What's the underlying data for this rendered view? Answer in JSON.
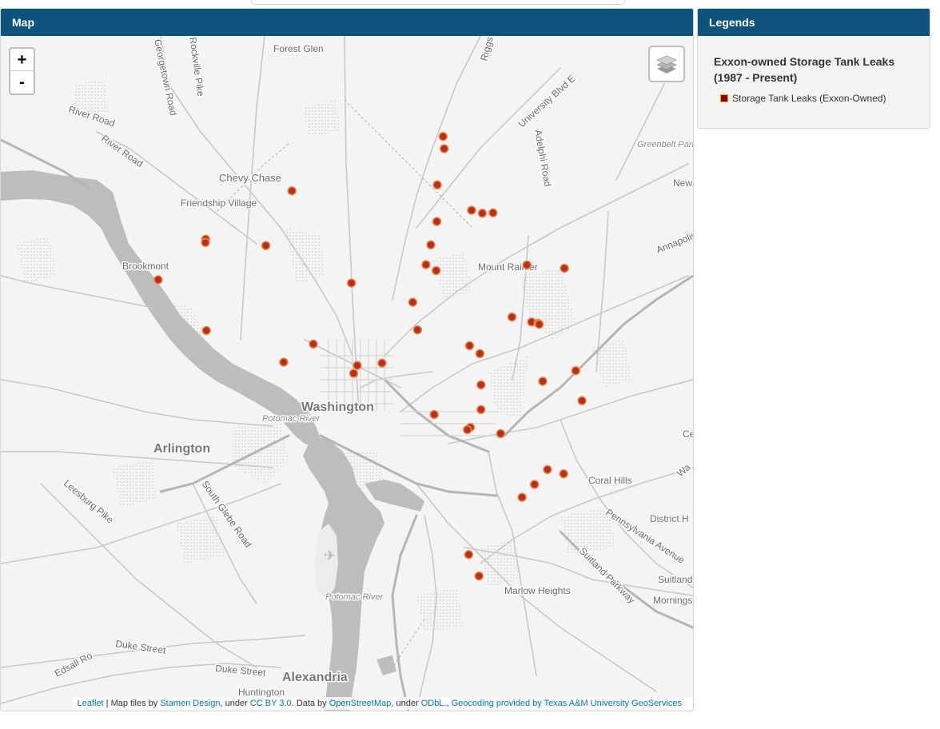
{
  "map_panel": {
    "title": "Map"
  },
  "legend_panel": {
    "title": "Legends",
    "layer_title": "Exxon-owned Storage Tank Leaks (1987 - Present)",
    "item_label": "Storage Tank Leaks (Exxon-Owned)",
    "swatch_fill": "#8b0000",
    "swatch_border": "#ffa500"
  },
  "zoom": {
    "in_label": "+",
    "out_label": "-"
  },
  "layers_control": {
    "icon": "layers-icon"
  },
  "colors": {
    "header": "#0e537c",
    "marker_fill": "#b5301f",
    "marker_stroke": "#f08c4a",
    "road": "#c8c8c8",
    "water": "#bcbcbc"
  },
  "place_labels": {
    "forest_glen": "Forest Glen",
    "chevy_chase": "Chevy Chase",
    "friendship_village": "Friendship Village",
    "brookmont": "Brookmont",
    "mount_rainier": "Mount Rainier",
    "washington": "Washington",
    "potomac_river_1": "Potomac River",
    "potomac_river_2": "Potomac River",
    "arlington": "Arlington",
    "coral_hills": "Coral Hills",
    "district_heights": "District H",
    "marlow_heights": "Marlow Heights",
    "alexandria": "Alexandria",
    "huntington": "Huntington",
    "new_carrollton": "New",
    "greenbelt_park": "Greenbelt Park",
    "suitland": "Suitland",
    "morningside": "Mornings",
    "capitol_heights": "Ce",
    "walker_mill": "Wa"
  },
  "road_labels": {
    "georgetown_road": "Georgetown Road",
    "rockville_pike": "Rockville Pike",
    "rhode_island_road": "Riggs Road",
    "university_blvd": "University Blvd E",
    "adelphi_road": "Adelphi Road",
    "river_road_1": "River Road",
    "river_road_2": "River Road",
    "annapolis": "Annapolis",
    "leesburg_pike": "Leesburg Pike",
    "south_glebe": "South Glebe Road",
    "pennsylvania_ave": "Pennsylvania Avenue",
    "suitland_parkway": "Suitland Parkway",
    "duke_street_1": "Duke Street",
    "duke_street_2": "Duke Street",
    "edsall_road": "Edsall Ro"
  },
  "markers": [
    {
      "lat": 38.9885,
      "lon": -77.0121
    },
    {
      "lat": 38.9848,
      "lon": -77.0116
    },
    {
      "lat": 38.9738,
      "lon": -77.0147
    },
    {
      "lat": 38.972,
      "lon": -77.0799
    },
    {
      "lat": 38.9661,
      "lon": -76.9993
    },
    {
      "lat": 38.9652,
      "lon": -76.9945
    },
    {
      "lat": 38.9653,
      "lon": -76.9897
    },
    {
      "lat": 38.9627,
      "lon": -77.0149
    },
    {
      "lat": 38.9573,
      "lon": -77.1186
    },
    {
      "lat": 38.9563,
      "lon": -77.1187
    },
    {
      "lat": 38.9554,
      "lon": -77.0916
    },
    {
      "lat": 38.9556,
      "lon": -77.0176
    },
    {
      "lat": 38.9496,
      "lon": -77.0198
    },
    {
      "lat": 38.9495,
      "lon": -76.9745
    },
    {
      "lat": 38.9478,
      "lon": -77.0152
    },
    {
      "lat": 38.9485,
      "lon": -76.9577
    },
    {
      "lat": 38.945,
      "lon": -77.1399
    },
    {
      "lat": 38.944,
      "lon": -77.0532
    },
    {
      "lat": 38.9382,
      "lon": -77.0257
    },
    {
      "lat": 38.9337,
      "lon": -76.9812
    },
    {
      "lat": 38.9322,
      "lon": -76.9724
    },
    {
      "lat": 38.9318,
      "lon": -76.9695
    },
    {
      "lat": 38.9315,
      "lon": -76.969
    },
    {
      "lat": 38.9298,
      "lon": -77.0236
    },
    {
      "lat": 38.9296,
      "lon": -77.1183
    },
    {
      "lat": 38.9255,
      "lon": -77.0703
    },
    {
      "lat": 38.925,
      "lon": -77.0002
    },
    {
      "lat": 38.9226,
      "lon": -76.9956
    },
    {
      "lat": 38.92,
      "lon": -77.0836
    },
    {
      "lat": 38.9197,
      "lon": -77.0395
    },
    {
      "lat": 38.919,
      "lon": -77.0506
    },
    {
      "lat": 38.9166,
      "lon": -77.0522
    },
    {
      "lat": 38.9174,
      "lon": -76.9526
    },
    {
      "lat": 38.9142,
      "lon": -76.9674
    },
    {
      "lat": 38.9131,
      "lon": -76.9951
    },
    {
      "lat": 38.9083,
      "lon": -76.9498
    },
    {
      "lat": 38.9056,
      "lon": -76.9951
    },
    {
      "lat": 38.9041,
      "lon": -77.0161
    },
    {
      "lat": 38.9002,
      "lon": -76.9999
    },
    {
      "lat": 38.8995,
      "lon": -77.0012
    },
    {
      "lat": 38.8983,
      "lon": -76.9863
    },
    {
      "lat": 38.8874,
      "lon": -76.9653
    },
    {
      "lat": 38.8861,
      "lon": -76.958
    },
    {
      "lat": 38.8829,
      "lon": -76.9711
    },
    {
      "lat": 38.879,
      "lon": -76.9767
    },
    {
      "lat": 38.8616,
      "lon": -77.0006
    },
    {
      "lat": 38.8551,
      "lon": -76.996
    }
  ]
}
